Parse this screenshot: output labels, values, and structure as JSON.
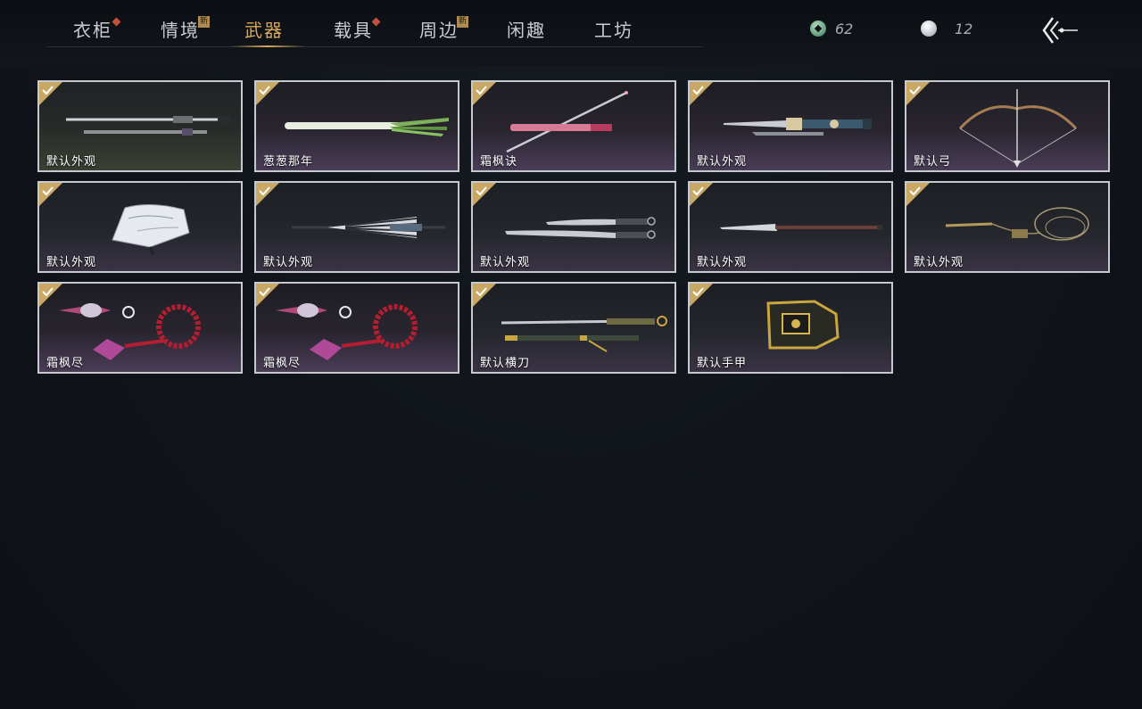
{
  "tabs": [
    {
      "label": "衣柜",
      "badge": "diamond"
    },
    {
      "label": "情境",
      "badge": "new"
    },
    {
      "label": "武器",
      "badge": "",
      "active": true
    },
    {
      "label": "载具",
      "badge": "diamond"
    },
    {
      "label": "周边",
      "badge": "new"
    },
    {
      "label": "闲趣",
      "badge": ""
    },
    {
      "label": "工坊",
      "badge": ""
    }
  ],
  "badge_new_text": "新",
  "currency": {
    "jade": {
      "icon": "jade-coin-icon",
      "value": "62"
    },
    "pearl": {
      "icon": "pearl-icon",
      "value": "12"
    }
  },
  "items": [
    {
      "label": "默认外观",
      "icon": "twin-spear-icon"
    },
    {
      "label": "葱葱那年",
      "icon": "scallion-weapon-icon"
    },
    {
      "label": "霜枫诀",
      "icon": "pink-sword-icon"
    },
    {
      "label": "默认外观",
      "icon": "ornate-sword-icon"
    },
    {
      "label": "默认弓",
      "icon": "bow-icon"
    },
    {
      "label": "默认外观",
      "icon": "folding-fan-icon"
    },
    {
      "label": "默认外观",
      "icon": "striped-umbrella-icon"
    },
    {
      "label": "默认外观",
      "icon": "dual-blades-icon"
    },
    {
      "label": "默认外观",
      "icon": "long-blade-icon"
    },
    {
      "label": "默认外观",
      "icon": "rope-dart-icon"
    },
    {
      "label": "霜枫尽",
      "icon": "prayer-beads-icon"
    },
    {
      "label": "霜枫尽",
      "icon": "prayer-beads-icon"
    },
    {
      "label": "默认横刀",
      "icon": "hengdao-icon"
    },
    {
      "label": "默认手甲",
      "icon": "gauntlet-icon"
    }
  ],
  "colors": {
    "accent_gold": "#d9a85c",
    "badge_red": "#c4513e",
    "card_border": "#c6c9ce",
    "background": "#10141a"
  }
}
